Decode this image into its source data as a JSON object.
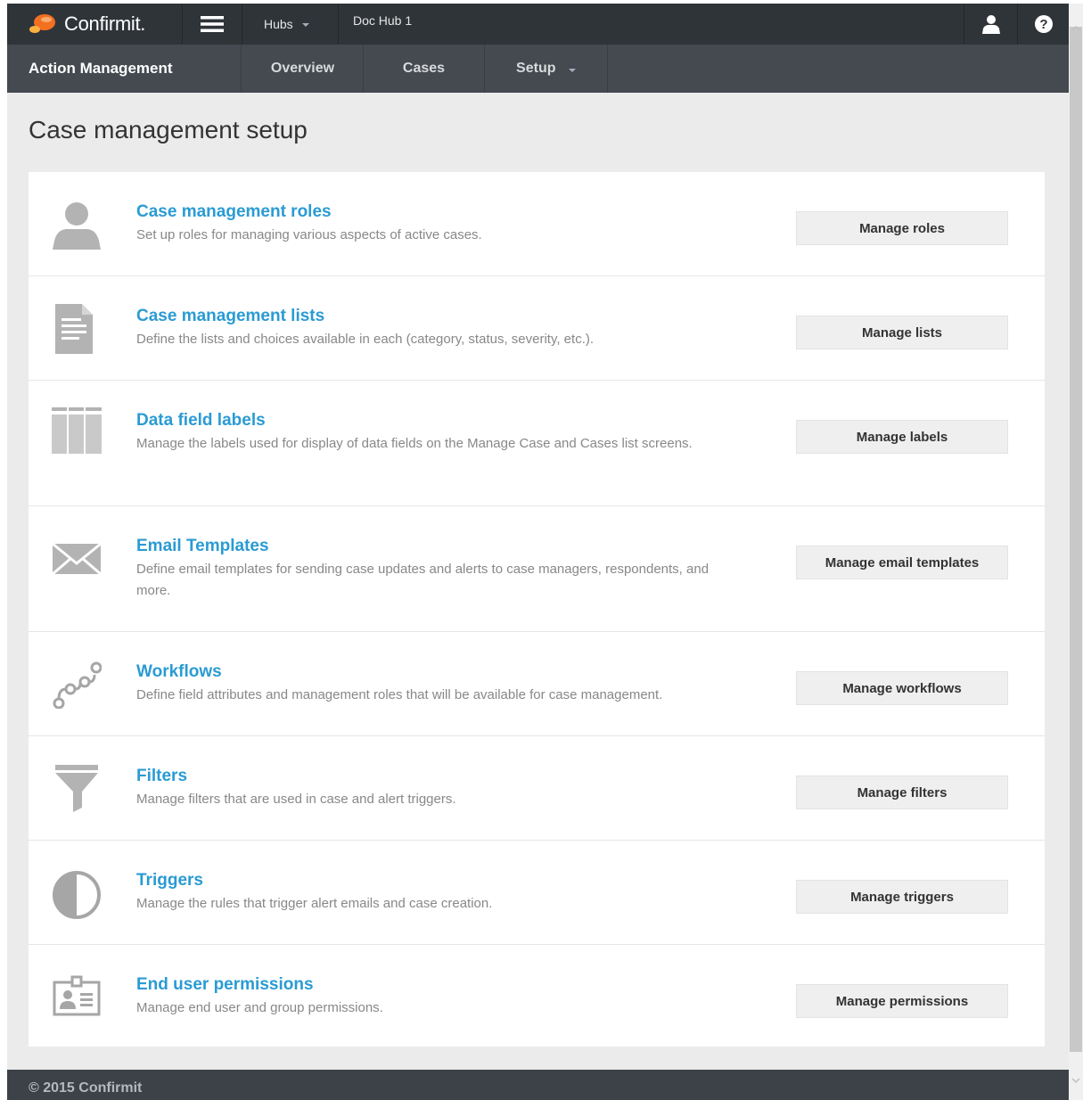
{
  "app": {
    "brand": "Confirmit.",
    "colors": {
      "accent": "#2a9bd3",
      "brand_orange": "#f37021",
      "topbar": "#2f3439",
      "subnav": "#444a50"
    }
  },
  "topbar": {
    "hubs_label": "Hubs",
    "current_hub": "Doc Hub 1"
  },
  "subnav": {
    "title": "Action Management",
    "tabs": [
      {
        "label": "Overview"
      },
      {
        "label": "Cases"
      },
      {
        "label": "Setup"
      }
    ]
  },
  "page": {
    "title": "Case management setup"
  },
  "rows": [
    {
      "icon": "user-icon",
      "title": "Case management roles",
      "desc": "Set up roles for managing various aspects of active cases.",
      "button": "Manage roles"
    },
    {
      "icon": "document-icon",
      "title": "Case management lists",
      "desc": "Define the lists and choices available in each (category, status, severity, etc.).",
      "button": "Manage lists"
    },
    {
      "icon": "columns-icon",
      "title": "Data field labels",
      "desc": "Manage the labels used for display of data fields on the Manage Case and Cases list screens.",
      "button": "Manage labels"
    },
    {
      "icon": "envelope-icon",
      "title": "Email Templates",
      "desc": "Define email templates for sending case updates and alerts to case managers, respondents, and more.",
      "button": "Manage email templates"
    },
    {
      "icon": "workflow-icon",
      "title": "Workflows",
      "desc": "Define field attributes and management roles that will be available for case management.",
      "button": "Manage workflows"
    },
    {
      "icon": "funnel-icon",
      "title": "Filters",
      "desc": "Manage filters that are used in case and alert triggers.",
      "button": "Manage filters"
    },
    {
      "icon": "half-circle-icon",
      "title": "Triggers",
      "desc": "Manage the rules that trigger alert emails and case creation.",
      "button": "Manage triggers"
    },
    {
      "icon": "id-card-icon",
      "title": "End user permissions",
      "desc": "Manage end user and group permissions.",
      "button": "Manage permissions"
    }
  ],
  "footer": {
    "text": "© 2015 Confirmit"
  }
}
